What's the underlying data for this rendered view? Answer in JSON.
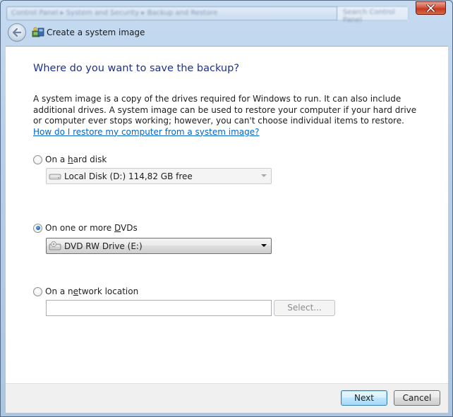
{
  "window": {
    "title": "Create a system image",
    "address_blurred": "Control Panel  ▸  System and Security  ▸  Backup and Restore",
    "search_blurred": "Search Control Panel"
  },
  "page": {
    "heading": "Where do you want to save the backup?",
    "description": "A system image is a copy of the drives required for Windows to run. It can also include additional drives. A system image can be used to restore your computer if your hard drive or computer ever stops working; however, you can't choose individual items to restore.",
    "help_link": "How do I restore my computer from a system image?"
  },
  "options": {
    "hard_disk": {
      "label_pre": "On a ",
      "label_access": "h",
      "label_post": "ard disk",
      "selected": false,
      "combo_value": "Local Disk (D:)  114,82 GB free",
      "enabled": false
    },
    "dvd": {
      "label_pre": "On one or more ",
      "label_access": "D",
      "label_post": "VDs",
      "selected": true,
      "combo_value": "DVD RW Drive (E:)",
      "enabled": true
    },
    "network": {
      "label_pre": "On a n",
      "label_access": "e",
      "label_post": "twork location",
      "selected": false,
      "input_value": "",
      "select_label": "Select..."
    }
  },
  "footer": {
    "next_label": "Next",
    "cancel_label": "Cancel"
  },
  "colors": {
    "heading": "#1e3287",
    "link": "#0066cc",
    "frame": "#bcd3ea",
    "close": "#c23a1f"
  }
}
